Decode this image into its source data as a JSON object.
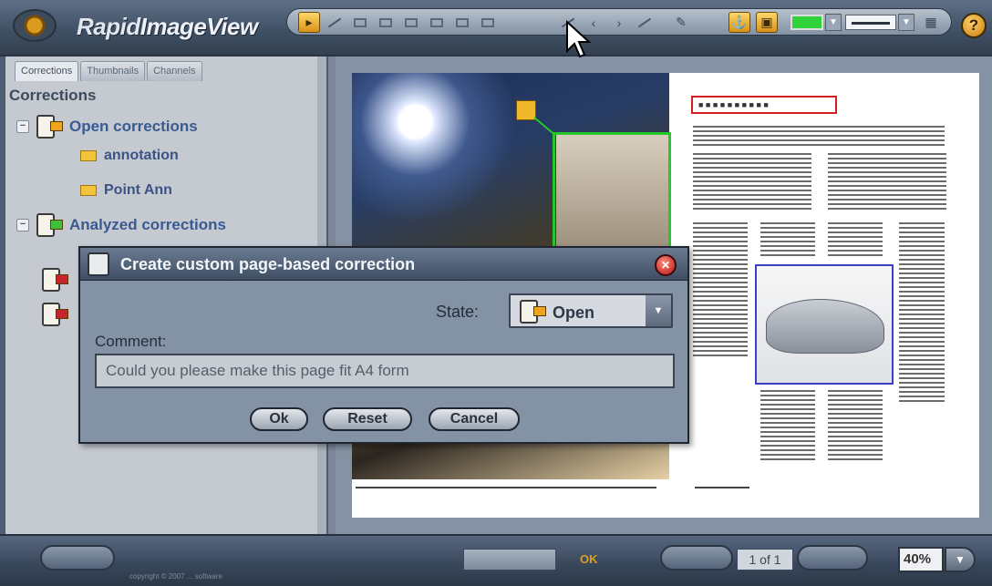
{
  "app": {
    "title_part1": "Rapid",
    "title_part2": "ImageView",
    "help_label": "?"
  },
  "colors": {
    "accent": "#d99a1e",
    "highlight_green": "#26c82a",
    "highlight_red": "#d31f1f",
    "highlight_blue": "#3d3fc4"
  },
  "toolbar": {
    "tools": [
      {
        "icon": "select-annotation-icon",
        "active": true
      },
      {
        "icon": "arrow-tool-icon"
      },
      {
        "icon": "rectangle-tool-icon"
      },
      {
        "icon": "rectangle-tool-icon"
      },
      {
        "icon": "rectangle-tool-icon"
      },
      {
        "icon": "rectangle-tool-icon"
      },
      {
        "icon": "rectangle-tool-icon"
      },
      {
        "icon": "rectangle-tool-icon"
      },
      {
        "icon": "line-tool-icon"
      },
      {
        "icon": "line-tool-icon"
      },
      {
        "icon": "line-tool-icon"
      },
      {
        "icon": "line-tool-icon"
      },
      {
        "icon": "pen-tool-icon"
      },
      {
        "icon": "anchor-icon",
        "active": true
      },
      {
        "icon": "note-icon",
        "active": true
      }
    ],
    "color_swatch": "#31d23a"
  },
  "tabs": [
    "Corrections",
    "Thumbnails",
    "Channels"
  ],
  "tree": {
    "heading": "Corrections",
    "groups": [
      {
        "label": "Open corrections",
        "children": [
          "annotation",
          "Point Ann"
        ]
      },
      {
        "label": "Analyzed corrections",
        "children": []
      }
    ]
  },
  "document": {
    "headline": "■ ■ ■ ■ ■ ■ ■ ■ ■ ■"
  },
  "dialog": {
    "title": "Create custom page-based correction",
    "close_label": "✕",
    "state_label": "State:",
    "state_value": "Open",
    "comment_label": "Comment:",
    "comment_value": "Could you please make this page fit A4 form",
    "ok_label": "Ok",
    "reset_label": "Reset",
    "cancel_label": "Cancel"
  },
  "status": {
    "ok_text": "OK",
    "page_indicator": "1 of 1",
    "zoom": "40%",
    "copyright": "copyright © 2007 ... software"
  }
}
